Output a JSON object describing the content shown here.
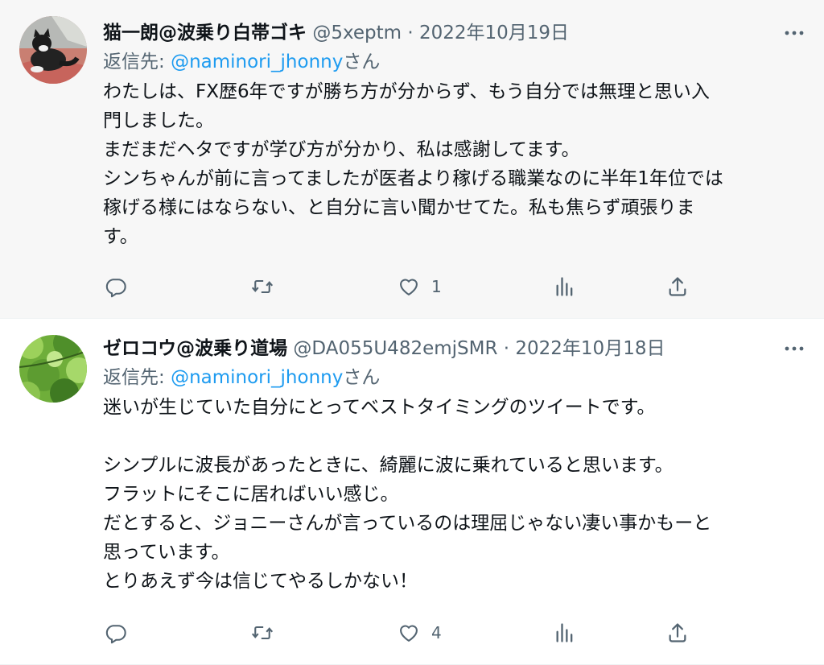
{
  "tweets": [
    {
      "name": "猫一朗@波乗り白帯ゴキ",
      "handle": "@5xeptm",
      "separator": "·",
      "date": "2022年10月19日",
      "reply_prefix": "返信先:",
      "reply_to": "@naminori_jhonny",
      "reply_suffix": "さん",
      "body": "わたしは、FX歴6年ですが勝ち方が分からず、もう自分では無理と思い入\n門しました。\nまだまだヘタですが学び方が分かり、私は感謝してます。\nシンちゃんが前に言ってましたが医者より稼げる職業なのに半年1年位では\n稼げる様にはならない、と自分に言い聞かせてた。私も焦らず頑張りま\nす。",
      "like_count": "1",
      "avatar_icon": "cat-avatar"
    },
    {
      "name": "ゼロコウ@波乗り道場",
      "handle": "@DA055U482emjSMR",
      "separator": "·",
      "date": "2022年10月18日",
      "reply_prefix": "返信先:",
      "reply_to": "@naminori_jhonny",
      "reply_suffix": "さん",
      "body": "迷いが生じていた自分にとってベストタイミングのツイートです。\n\nシンプルに波長があったときに、綺麗に波に乗れていると思います。\nフラットにそこに居ればいい感じ。\nだとすると、ジョニーさんが言っているのは理屈じゃない凄い事かもーと\n思っています。\nとりあえず今は信じてやるしかない！",
      "like_count": "4",
      "avatar_icon": "leaves-avatar"
    }
  ],
  "icons": {
    "reply": "reply-icon",
    "retweet": "retweet-icon",
    "like": "heart-icon",
    "views": "views-icon",
    "share": "share-icon",
    "more": "more-icon"
  },
  "colors": {
    "accent": "#1d9bf0",
    "secondary_text": "#536471",
    "primary_text": "#0f1419",
    "highlight_bg": "#f7f7f7"
  }
}
